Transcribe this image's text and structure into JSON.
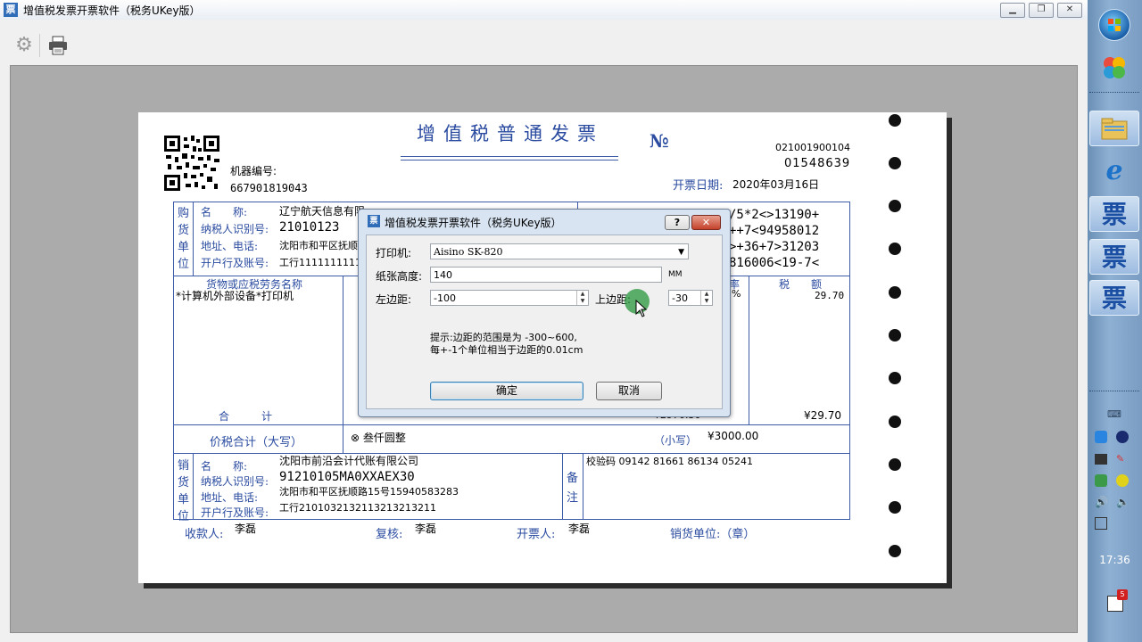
{
  "window": {
    "title": "增值税发票开票软件（税务UKey版）",
    "icon_glyph": "票",
    "controls": [
      "minimize-icon",
      "restore-icon",
      "close-icon"
    ]
  },
  "toolbar": {
    "icons": [
      "gear-icon",
      "printer-icon"
    ]
  },
  "invoice": {
    "title": "增值税普通发票",
    "no_symbol": "№",
    "code": "021001900104",
    "number": "01548639",
    "date_label": "开票日期:",
    "date": "2020年03月16日",
    "machine_label": "机器编号:",
    "machine_no": "667901819043",
    "buyer": {
      "section_label": "购货单位",
      "name_label": "名　　称:",
      "name": "辽宁航天信息有限",
      "tax_label": "纳税人识别号:",
      "tax_id": "21010123",
      "addr_label": "地址、电话:",
      "addr": "沈阳市和平区抚顺",
      "bank_label": "开户行及账号:",
      "bank": "工行1111111111"
    },
    "cipher": [
      "/5*2<>13190+",
      "++7<94958012",
      ">+36+7>31203",
      "816006<19-7<"
    ],
    "goods_header": "货物或应税劳务名称",
    "rate_header": "率",
    "tax_header": "税　　额",
    "item_name": "*计算机外部设备*打印机",
    "item_rate": "%",
    "item_tax": "29.70",
    "total_label": "合　　　计",
    "total_amount_partial": "¥2970.30",
    "total_tax": "¥29.70",
    "grand_label": "价税合计（大写）",
    "grand_words": "⊗ 叁仟圆整",
    "small_label": "（小写）",
    "grand_small": "¥3000.00",
    "seller": {
      "section_label": "销货单位",
      "name_label": "名　　称:",
      "name": "沈阳市前沿会计代账有限公司",
      "tax_label": "纳税人识别号:",
      "tax_id": "91210105MA0XXAEX30",
      "addr_label": "地址、电话:",
      "addr": "沈阳市和平区抚顺路15号15940583283",
      "bank_label": "开户行及账号:",
      "bank": "工行2101032132113213213211"
    },
    "remark_label": "备注",
    "check_code": "校验码 09142 81661 86134 05241",
    "payee_label": "收款人:",
    "payee": "李磊",
    "reviewer_label": "复核:",
    "reviewer": "李磊",
    "drawer_label": "开票人:",
    "drawer": "李磊",
    "seal_label": "销货单位:（章）"
  },
  "dialog": {
    "title": "增值税发票开票软件（税务UKey版）",
    "help_button": "?",
    "close_button": "✕",
    "printer_label": "打印机:",
    "printer_value": "Aisino SK-820",
    "height_label": "纸张高度:",
    "height_value": "140",
    "height_unit": "MM",
    "left_label": "左边距:",
    "left_value": "-100",
    "top_label": "上边距:",
    "top_value": "-30",
    "hint_line1": "提示:边距的范围是为 -300~600,",
    "hint_line2": "每+-1个单位相当于边距的0.01cm",
    "ok_label": "确定",
    "cancel_label": "取消"
  },
  "taskbar": {
    "time": "17:36",
    "notification_count": "5",
    "app_glyph": "票"
  }
}
